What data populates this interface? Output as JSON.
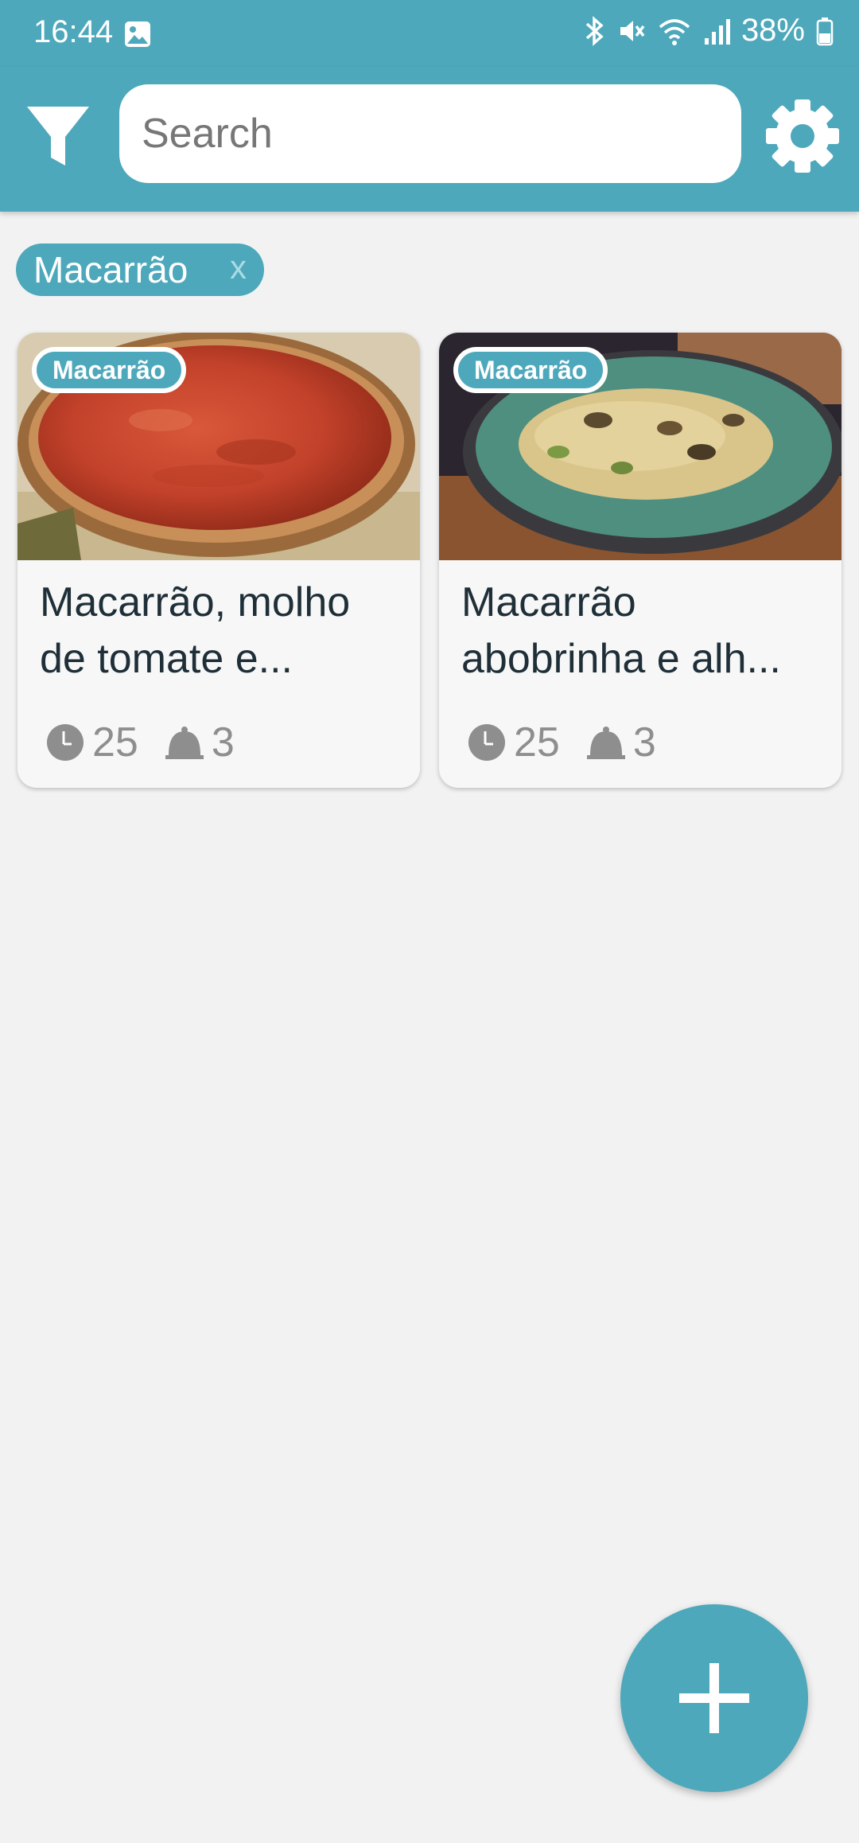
{
  "status_bar": {
    "time": "16:44",
    "battery": "38%",
    "icons": [
      "gallery-icon",
      "bluetooth-icon",
      "mute-icon",
      "wifi-icon",
      "signal-icon",
      "battery-icon"
    ]
  },
  "app_bar": {
    "search_placeholder": "Search",
    "filter_icon": "filter-icon",
    "settings_icon": "gear-icon"
  },
  "active_filter": {
    "label": "Macarrão",
    "close": "x"
  },
  "recipes": [
    {
      "tag": "Macarrão",
      "title": "Macarrão, molho de tomate e...",
      "time": "25",
      "servings": "3"
    },
    {
      "tag": "Macarrão",
      "title": "Macarrão abobrinha e alh...",
      "time": "25",
      "servings": "3"
    }
  ],
  "colors": {
    "primary": "#4ea8bb",
    "background": "#f2f2f2",
    "card": "#f7f7f7",
    "text": "#1f2f38",
    "meta": "#8e8e8e"
  }
}
